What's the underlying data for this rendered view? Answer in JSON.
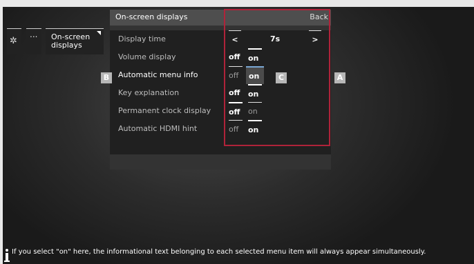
{
  "breadcrumb": {
    "settings_icon": "gear-icon",
    "more_label": "...",
    "current_label": "On-screen\ndisplays"
  },
  "panel": {
    "title": "On-screen displays",
    "back_label": "Back"
  },
  "rows": [
    {
      "label": "Display time",
      "prev": "<",
      "value": "7s",
      "next": ">"
    },
    {
      "label": "Volume display",
      "off": "off",
      "on": "on",
      "selected": "on"
    },
    {
      "label": "Automatic menu info",
      "off": "off",
      "on": "on",
      "selected": "on",
      "active": true
    },
    {
      "label": "Key explanation",
      "off": "off",
      "on": "on",
      "selected": "on"
    },
    {
      "label": "Permanent clock display",
      "off": "off",
      "on": "on",
      "selected": "off"
    },
    {
      "label": "Automatic HDMI hint",
      "off": "off",
      "on": "on",
      "selected": "on"
    }
  ],
  "annotations": {
    "a": "A",
    "b": "B",
    "c": "C",
    "box_color": "#b0233a"
  },
  "info": {
    "icon": "info-icon",
    "text": "If you select \"on\" here, the informational text belonging to each selected menu item will always appear simultaneously."
  },
  "colors": {
    "highlight": "#7aa8d6",
    "panel_header": "#4e4e4e"
  }
}
